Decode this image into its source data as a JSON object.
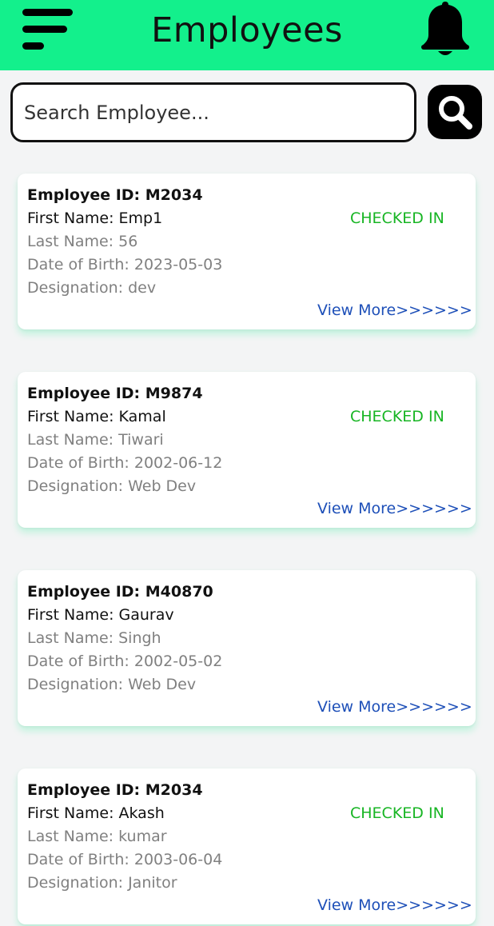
{
  "header": {
    "title": "Employees"
  },
  "search": {
    "placeholder": "Search Employee..."
  },
  "employees": [
    {
      "id_text": "Employee ID: M2034",
      "first_name_text": "First Name: Emp1",
      "last_name_text": "Last Name: 56",
      "dob_text": "Date of Birth: 2023-05-03",
      "designation_text": "Designation: dev",
      "status": "CHECKED IN",
      "view_more": "View More>>>>>>"
    },
    {
      "id_text": "Employee ID: M9874",
      "first_name_text": "First Name: Kamal",
      "last_name_text": "Last Name: Tiwari",
      "dob_text": "Date of Birth: 2002-06-12",
      "designation_text": "Designation: Web Dev",
      "status": "CHECKED IN",
      "view_more": "View More>>>>>>"
    },
    {
      "id_text": "Employee ID: M40870",
      "first_name_text": "First Name: Gaurav",
      "last_name_text": "Last Name: Singh",
      "dob_text": "Date of Birth: 2002-05-02",
      "designation_text": "Designation: Web Dev",
      "status": "",
      "view_more": "View More>>>>>>"
    },
    {
      "id_text": "Employee ID: M2034",
      "first_name_text": "First Name: Akash",
      "last_name_text": "Last Name: kumar",
      "dob_text": "Date of Birth: 2003-06-04",
      "designation_text": "Designation: Janitor",
      "status": "CHECKED IN",
      "view_more": "View More>>>>>>"
    }
  ],
  "colors": {
    "header_bg": "#13f08c",
    "status_checked_in": "#17b523",
    "link": "#1d4fb8"
  },
  "icons": {
    "menu": "hamburger-menu-icon",
    "notification": "bell-icon",
    "search": "magnifier-icon"
  }
}
